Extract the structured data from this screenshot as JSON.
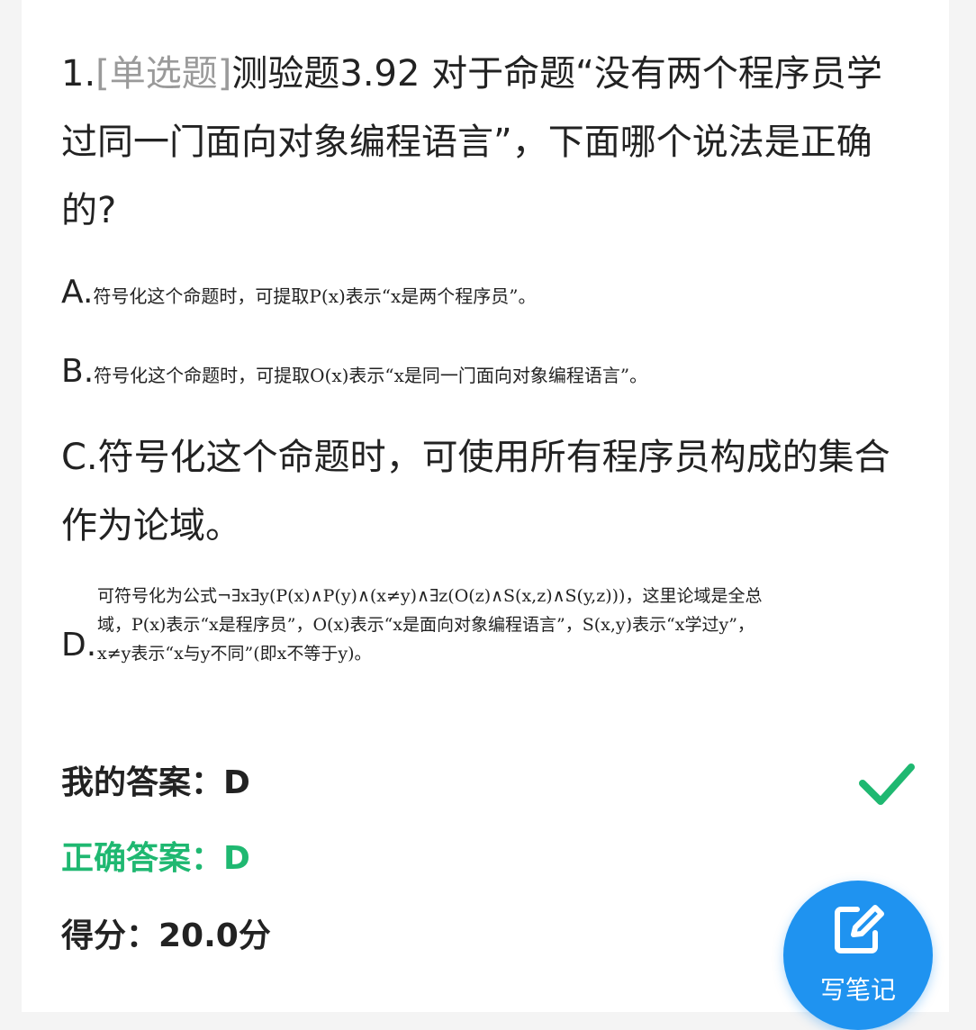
{
  "question": {
    "number": "1.",
    "type": "[单选题]",
    "text": "测验题3.92 对于命题“没有两个程序员学过同一门面向对象编程语言”，下面哪个说法是正确的?"
  },
  "options": {
    "A": {
      "letter": "A.",
      "text": "符号化这个命题时，可提取P(x)表示“x是两个程序员”。"
    },
    "B": {
      "letter": "B.",
      "text": "符号化这个命题时，可提取O(x)表示“x是同一门面向对象编程语言”。"
    },
    "C": {
      "letter": "C.",
      "text": "符号化这个命题时，可使用所有程序员构成的集合作为论域。"
    },
    "D": {
      "letter": "D.",
      "text": "可符号化为公式¬∃x∃y(P(x)∧P(y)∧(x≠y)∧∃z(O(z)∧S(x,z)∧S(y,z)))，这里论域是全总域，P(x)表示“x是程序员”，O(x)表示“x是面向对象编程语言”，S(x,y)表示“x学过y”，x≠y表示“x与y不同”(即x不等于y)。"
    }
  },
  "result": {
    "my_answer": "我的答案：D",
    "correct_answer": "正确答案：D",
    "score": "得分：20.0分"
  },
  "icons": {
    "check": "check-icon",
    "note": "edit-note-icon"
  },
  "colors": {
    "correct": "#1fb871",
    "fab": "#1f93f0",
    "qtype": "#9a9a9a"
  },
  "fab": {
    "label": "写笔记"
  }
}
